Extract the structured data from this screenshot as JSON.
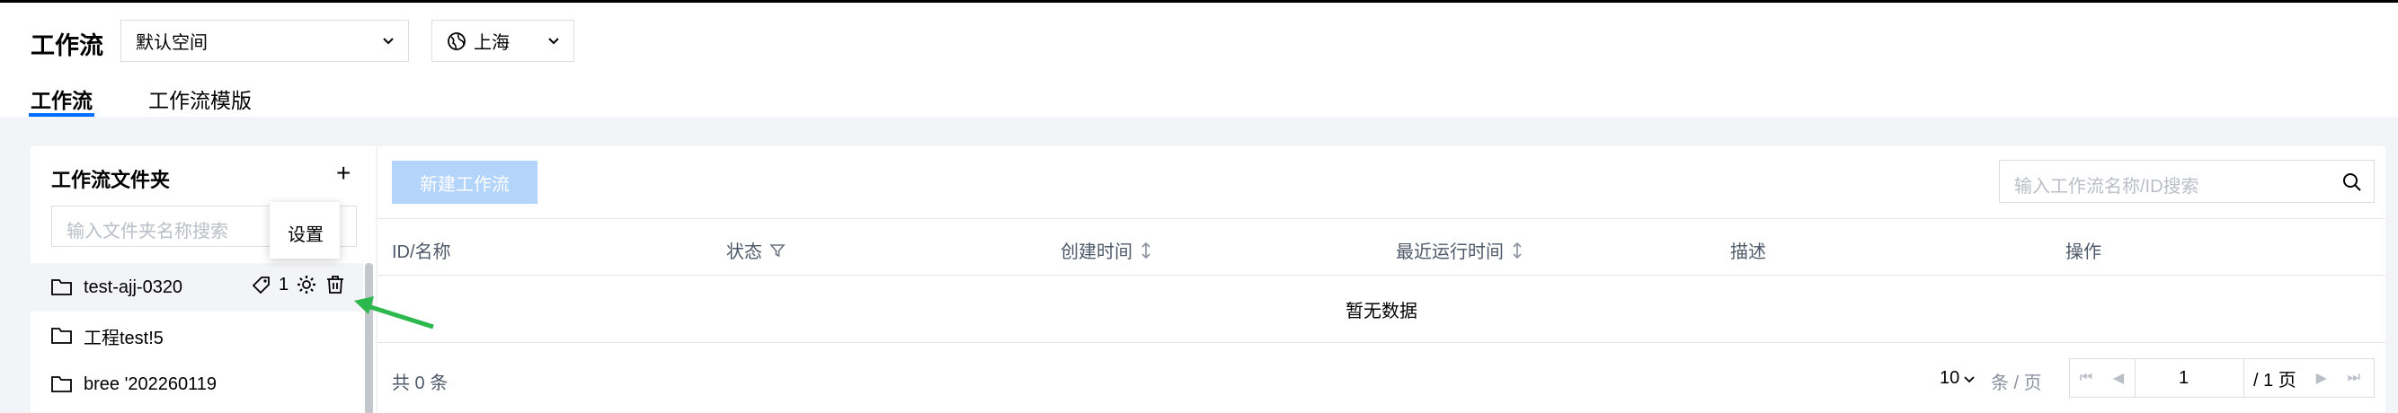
{
  "header": {
    "title": "工作流",
    "space_select": "默认空间",
    "region_select": "上海",
    "tabs": [
      "工作流",
      "工作流模版"
    ]
  },
  "sidebar": {
    "title": "工作流文件夹",
    "add_symbol": "+",
    "search_placeholder": "输入文件夹名称搜索",
    "items": [
      {
        "label": "test-ajj-0320",
        "tag_count": "1"
      },
      {
        "label": "工程test!5"
      },
      {
        "label": "bree   '202260119"
      }
    ],
    "tooltip": "设置"
  },
  "main": {
    "new_button": "新建工作流",
    "search_placeholder": "输入工作流名称/ID搜索",
    "columns": [
      "ID/名称",
      "状态",
      "创建时间",
      "最近运行时间",
      "描述",
      "操作"
    ],
    "empty_text": "暂无数据",
    "total": "共 0 条",
    "page_size": "10",
    "page_size_unit": "条 / 页",
    "current_page": "1",
    "page_total": "/ 1 页"
  },
  "colors": {
    "accent": "#006eff",
    "button_disabled": "#b3d4fb",
    "arrow": "#2db84d"
  }
}
